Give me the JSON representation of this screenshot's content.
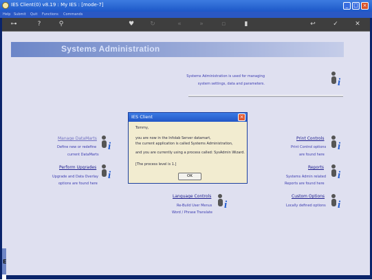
{
  "window": {
    "title": "IES Client(0) v8.19 : My IES :      [mode-7]",
    "minimize": "_",
    "maximize": "□",
    "close": "×"
  },
  "menubar": {
    "items": [
      "Help",
      "Submit",
      "Quit",
      "Functions",
      "Commands"
    ]
  },
  "toolbar": {
    "icons": [
      "key-icon",
      "help-icon",
      "search-icon",
      "heart-icon",
      "refresh-icon",
      "rewind-icon",
      "fast-forward-icon",
      "stop-icon",
      "copy-icon",
      "back-icon",
      "ok-icon",
      "close-icon"
    ]
  },
  "left_strip": {
    "glyph": "E"
  },
  "page": {
    "title": "Systems Administration",
    "intro_line1": "Systems Administration is used for managing",
    "intro_line2": "system settings, data and parameters."
  },
  "sections": {
    "manage_datamarts": {
      "label": "Manage DataMarts",
      "line1": "Define new or redefine",
      "line2": "current DataMarts"
    },
    "perform_upgrades": {
      "label": "Perform Upgrades",
      "line1": "Upgrade and Data Overlay",
      "line2": "options are found here"
    },
    "language_controls": {
      "label": "Language Controls",
      "line1": "Re-Build User Menus",
      "line2": "Word / Phrase Translate"
    },
    "print_controls": {
      "label": "Print Controls",
      "line1": "Print Control options",
      "line2": "are found here"
    },
    "reports": {
      "label": "Reports",
      "line1": "Systems Admin related",
      "line2": "Reports are found here"
    },
    "custom_options": {
      "label": "Custom Options",
      "line1": "Locally defined options"
    }
  },
  "dialog": {
    "title": "IES Client",
    "close": "×",
    "line1": "Tommy,",
    "line2": "you are now in the Infolab Server datamart,",
    "line3": "the current application is called Systems Administration,",
    "line4": "and you are currently using a process called: SysAdmin Wizard.",
    "line5": "[The process level is 1.]",
    "ok_label": "OK"
  },
  "colors": {
    "accent": "#2257c6",
    "content_bg": "#dfe0f0",
    "dialog_bg": "#f2ecd0",
    "link": "#1a1a8c",
    "info_icon": "#1f5bd0"
  }
}
